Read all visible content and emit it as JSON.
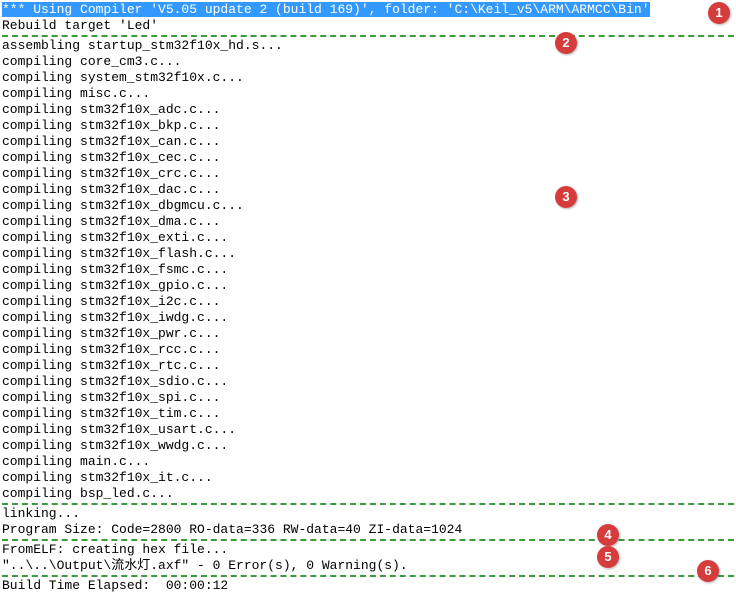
{
  "header": "*** Using Compiler 'V5.05 update 2 (build 169)', folder: 'C:\\Keil_v5\\ARM\\ARMCC\\Bin'",
  "rebuild": "Rebuild target 'Led'",
  "lines": [
    "assembling startup_stm32f10x_hd.s...",
    "compiling core_cm3.c...",
    "compiling system_stm32f10x.c...",
    "compiling misc.c...",
    "compiling stm32f10x_adc.c...",
    "compiling stm32f10x_bkp.c...",
    "compiling stm32f10x_can.c...",
    "compiling stm32f10x_cec.c...",
    "compiling stm32f10x_crc.c...",
    "compiling stm32f10x_dac.c...",
    "compiling stm32f10x_dbgmcu.c...",
    "compiling stm32f10x_dma.c...",
    "compiling stm32f10x_exti.c...",
    "compiling stm32f10x_flash.c...",
    "compiling stm32f10x_fsmc.c...",
    "compiling stm32f10x_gpio.c...",
    "compiling stm32f10x_i2c.c...",
    "compiling stm32f10x_iwdg.c...",
    "compiling stm32f10x_pwr.c...",
    "compiling stm32f10x_rcc.c...",
    "compiling stm32f10x_rtc.c...",
    "compiling stm32f10x_sdio.c...",
    "compiling stm32f10x_spi.c...",
    "compiling stm32f10x_tim.c...",
    "compiling stm32f10x_usart.c...",
    "compiling stm32f10x_wwdg.c...",
    "compiling main.c...",
    "compiling stm32f10x_it.c...",
    "compiling bsp_led.c..."
  ],
  "linking": "linking...",
  "progsize": "Program Size: Code=2800 RO-data=336 RW-data=40 ZI-data=1024  ",
  "fromelf": "FromELF: creating hex file...",
  "result": "\"..\\..\\Output\\流水灯.axf\" - 0 Error(s), 0 Warning(s).",
  "elapsed": "Build Time Elapsed:  00:00:12",
  "badges": {
    "b1": "1",
    "b2": "2",
    "b3": "3",
    "b4": "4",
    "b5": "5",
    "b6": "6"
  }
}
